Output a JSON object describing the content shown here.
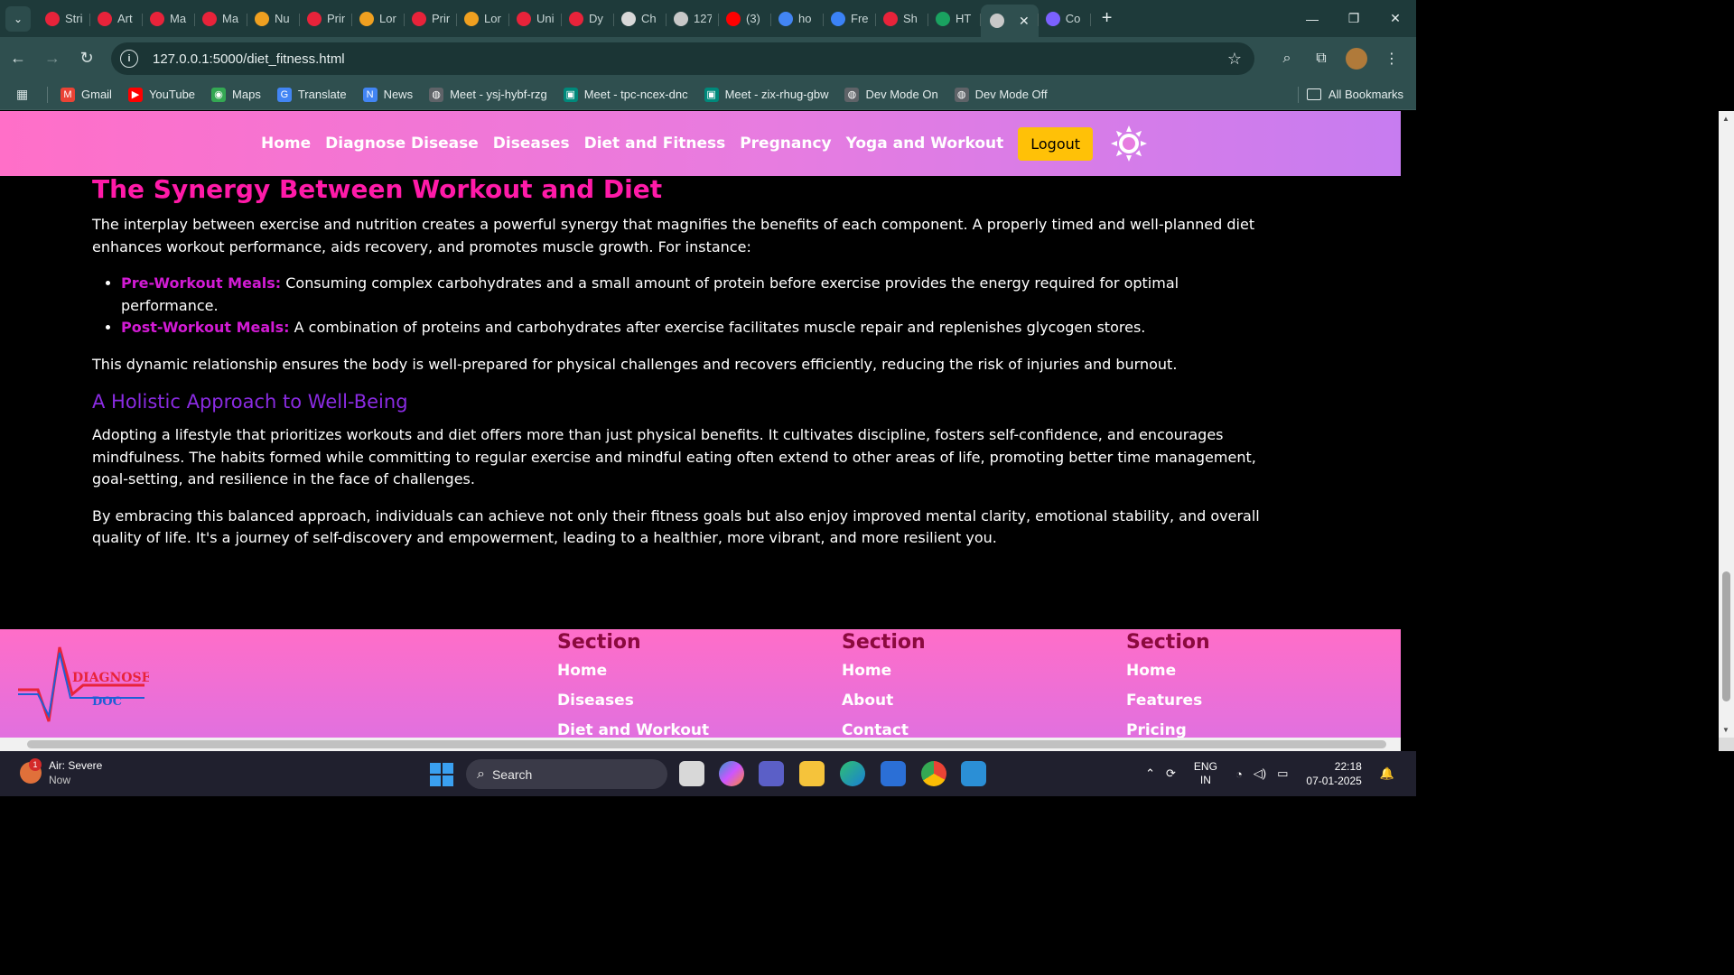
{
  "browser": {
    "tabs": [
      {
        "label": "Stri",
        "color": "#e8233a"
      },
      {
        "label": "Art",
        "color": "#e8233a"
      },
      {
        "label": "Ma",
        "color": "#e8233a"
      },
      {
        "label": "Ma",
        "color": "#e8233a"
      },
      {
        "label": "Nu",
        "color": "#f0a020"
      },
      {
        "label": "Prin",
        "color": "#e8233a"
      },
      {
        "label": "Lor",
        "color": "#f0a020"
      },
      {
        "label": "Prin",
        "color": "#e8233a"
      },
      {
        "label": "Lor",
        "color": "#f0a020"
      },
      {
        "label": "Uni",
        "color": "#e8233a"
      },
      {
        "label": "Dy",
        "color": "#e8233a"
      },
      {
        "label": "Ch",
        "color": "#d8d8d8"
      },
      {
        "label": "127",
        "color": "#c8c8c8"
      },
      {
        "label": "(3)",
        "color": "#ff0000"
      },
      {
        "label": "ho",
        "color": "#4285f4"
      },
      {
        "label": "Fre",
        "color": "#3b82f6"
      },
      {
        "label": "Sh",
        "color": "#e8233a"
      },
      {
        "label": "HT",
        "color": "#1aa260"
      }
    ],
    "active_tab": {
      "label": "",
      "close": "✕"
    },
    "last_tab": {
      "label": "Co",
      "color": "#7b61ff"
    },
    "new_tab": "+",
    "url": "127.0.0.1:5000/diet_fitness.html",
    "window_controls": {
      "minimize": "—",
      "maximize": "❐",
      "close": "✕"
    },
    "bookmarks": [
      {
        "label": "Gmail",
        "icon": "M",
        "color": "#ea4335"
      },
      {
        "label": "YouTube",
        "icon": "▶",
        "color": "#ff0000"
      },
      {
        "label": "Maps",
        "icon": "◉",
        "color": "#34a853"
      },
      {
        "label": "Translate",
        "icon": "G",
        "color": "#4285f4"
      },
      {
        "label": "News",
        "icon": "N",
        "color": "#4285f4"
      },
      {
        "label": "Meet - ysj-hybf-rzg",
        "icon": "◍",
        "color": "#5f6368"
      },
      {
        "label": "Meet - tpc-ncex-dnc",
        "icon": "▣",
        "color": "#00897b"
      },
      {
        "label": "Meet - zix-rhug-gbw",
        "icon": "▣",
        "color": "#00897b"
      },
      {
        "label": "Dev Mode On",
        "icon": "◍",
        "color": "#5f6368"
      },
      {
        "label": "Dev Mode Off",
        "icon": "◍",
        "color": "#5f6368"
      }
    ],
    "all_bookmarks": "All Bookmarks"
  },
  "site": {
    "nav": [
      "Home",
      "Diagnose Disease",
      "Diseases",
      "Diet and Fitness",
      "Pregnancy",
      "Yoga and Workout"
    ],
    "logout": "Logout",
    "heading": "The Synergy Between Workout and Diet",
    "intro": "The interplay between exercise and nutrition creates a powerful synergy that magnifies the benefits of each component. A properly timed and well-planned diet enhances workout performance, aids recovery, and promotes muscle growth. For instance:",
    "bullets": [
      {
        "term": "Pre-Workout Meals:",
        "text": " Consuming complex carbohydrates and a small amount of protein before exercise provides the energy required for optimal performance."
      },
      {
        "term": "Post-Workout Meals:",
        "text": " A combination of proteins and carbohydrates after exercise facilitates muscle repair and replenishes glycogen stores."
      }
    ],
    "relationship": "This dynamic relationship ensures the body is well-prepared for physical challenges and recovers efficiently, reducing the risk of injuries and burnout.",
    "subheading": "A Holistic Approach to Well-Being",
    "holistic": "Adopting a lifestyle that prioritizes workouts and diet offers more than just physical benefits. It cultivates discipline, fosters self-confidence, and encourages mindfulness. The habits formed while committing to regular exercise and mindful eating often extend to other areas of life, promoting better time management, goal-setting, and resilience in the face of challenges.",
    "closing": "By embracing this balanced approach, individuals can achieve not only their fitness goals but also enjoy improved mental clarity, emotional stability, and overall quality of life. It's a journey of self-discovery and empowerment, leading to a healthier, more vibrant, and more resilient you."
  },
  "footer": {
    "logo_text": [
      "DIAGNOSE",
      "DOC"
    ],
    "columns": [
      {
        "heading": "Section",
        "links": [
          "Home",
          "Diseases",
          "Diet and Workout"
        ]
      },
      {
        "heading": "Section",
        "links": [
          "Home",
          "About",
          "Contact"
        ]
      },
      {
        "heading": "Section",
        "links": [
          "Home",
          "Features",
          "Pricing"
        ]
      }
    ]
  },
  "taskbar": {
    "weather_title": "Air: Severe",
    "weather_sub": "Now",
    "weather_badge": "1",
    "search": "Search",
    "lang": [
      "ENG",
      "IN"
    ],
    "time": "22:18",
    "date": "07-01-2025"
  }
}
